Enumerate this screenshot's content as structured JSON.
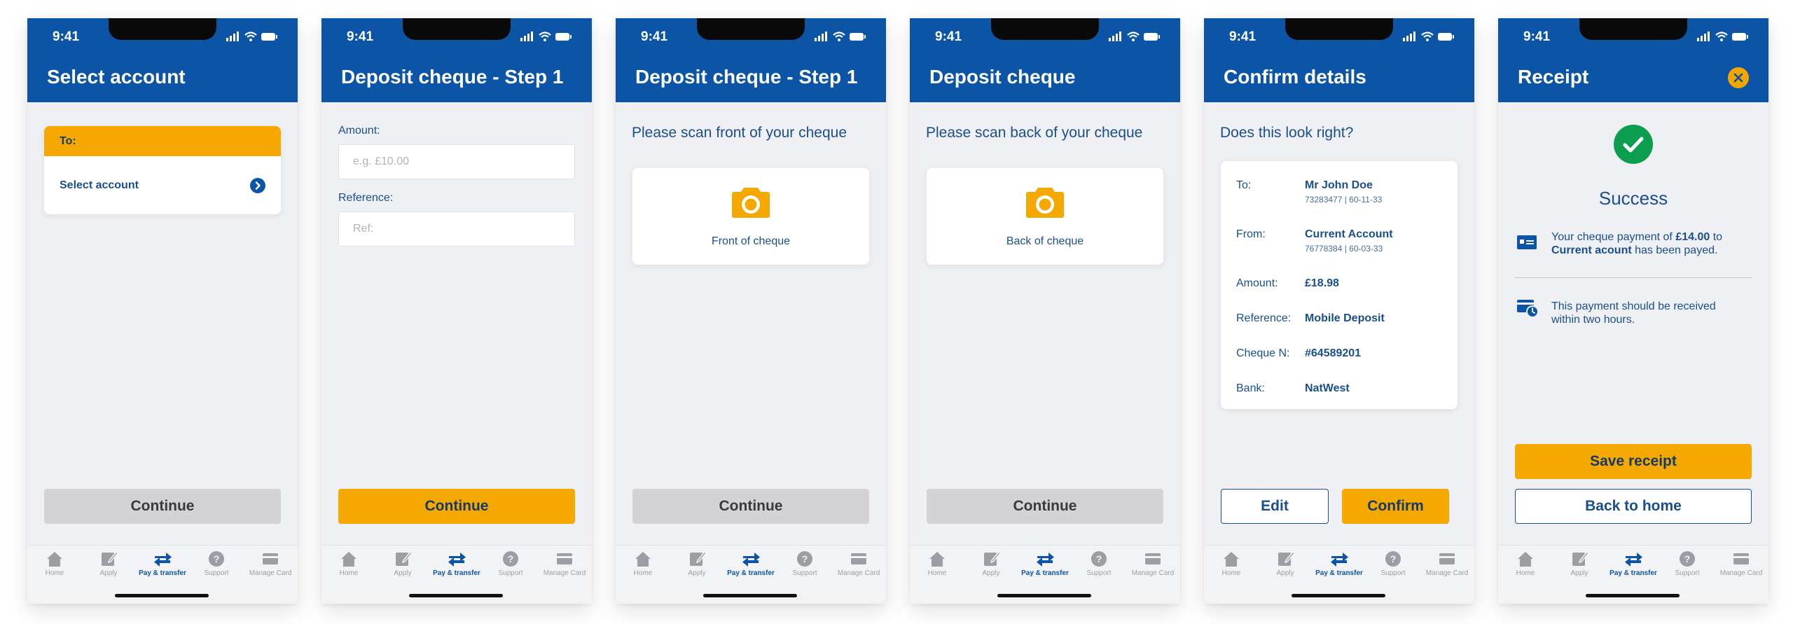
{
  "status_time": "9:41",
  "tabbar": [
    "Home",
    "Apply",
    "Pay & transfer",
    "Support",
    "Manage Card"
  ],
  "screens": {
    "select_account": {
      "title": "Select account",
      "to_label": "To:",
      "select_label": "Select account",
      "continue": "Continue"
    },
    "step1_amount": {
      "title": "Deposit cheque - Step 1",
      "amount_label": "Amount:",
      "amount_placeholder": "e.g. £10.00",
      "reference_label": "Reference:",
      "reference_placeholder": "Ref:",
      "continue": "Continue"
    },
    "step1_front": {
      "title": "Deposit cheque - Step 1",
      "prompt": "Please scan front of your cheque",
      "scan_label": "Front of cheque",
      "continue": "Continue"
    },
    "scan_back": {
      "title": "Deposit cheque",
      "prompt": "Please scan back of your cheque",
      "scan_label": "Back of cheque",
      "continue": "Continue"
    },
    "confirm": {
      "title": "Confirm details",
      "question": "Does this look right?",
      "rows": [
        {
          "label": "To:",
          "value": "Mr John Doe",
          "sub": "73283477 | 60-11-33"
        },
        {
          "label": "From:",
          "value": "Current Account",
          "sub": "76778384 | 60-03-33"
        },
        {
          "label": "Amount:",
          "value": "£18.98"
        },
        {
          "label": "Reference:",
          "value": "Mobile Deposit"
        },
        {
          "label": "Cheque N:",
          "value": "#64589201"
        },
        {
          "label": "Bank:",
          "value": "NatWest"
        }
      ],
      "edit": "Edit",
      "confirm": "Confirm"
    },
    "receipt": {
      "title": "Receipt",
      "success": "Success",
      "msg1_a": "Your cheque payment of ",
      "msg1_amount": "£14.00",
      "msg1_b": " to",
      "msg1_account": "Current acount",
      "msg1_c": " has been payed.",
      "msg2": "This payment should be received within two hours.",
      "save": "Save receipt",
      "back": "Back to home"
    }
  },
  "colors": {
    "brand_blue": "#0c55a6",
    "accent_yellow": "#f5a800",
    "success_green": "#0a9e4e",
    "text_blue": "#1a4e8c",
    "disabled_grey": "#d3d3d5"
  }
}
